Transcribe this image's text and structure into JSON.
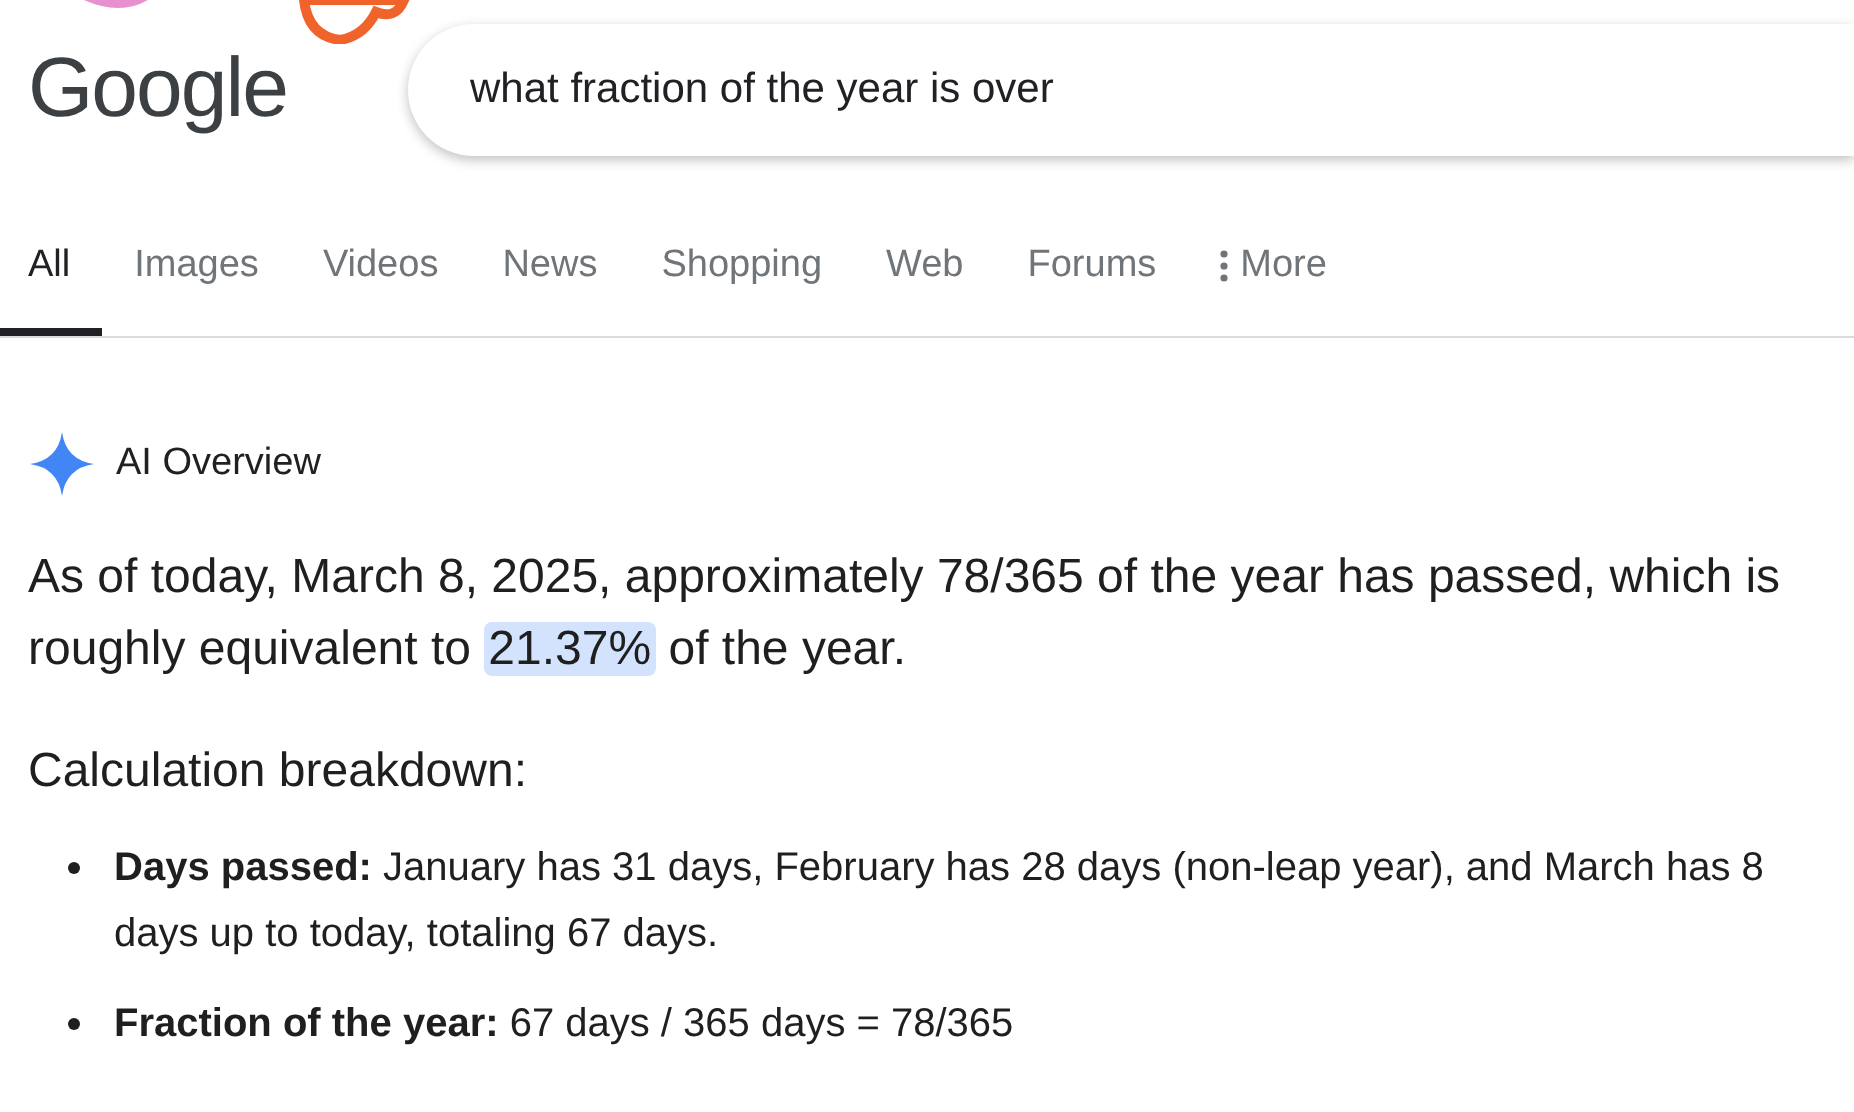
{
  "logo": "Google",
  "search": {
    "value": "what fraction of the year is over"
  },
  "tabs": [
    {
      "label": "All",
      "selected": true
    },
    {
      "label": "Images",
      "selected": false
    },
    {
      "label": "Videos",
      "selected": false
    },
    {
      "label": "News",
      "selected": false
    },
    {
      "label": "Shopping",
      "selected": false
    },
    {
      "label": "Web",
      "selected": false
    },
    {
      "label": "Forums",
      "selected": false
    },
    {
      "label": "More",
      "selected": false,
      "kind": "menu"
    }
  ],
  "ai_overview": {
    "title": "AI Overview",
    "summary": {
      "before": "As of today, March 8, 2025, approximately 78/365 of the year has passed, which is roughly equivalent to",
      "highlight": "21.37%",
      "after": "of the year."
    },
    "heading": "Calculation breakdown:",
    "bullets": [
      "**Days passed:** January has 31 days, February has 28 days (non-leap year), and March has 8 days up to today, totaling 67 days.",
      "**Fraction of the year:** 67 days / 365 days = 78/365"
    ]
  }
}
